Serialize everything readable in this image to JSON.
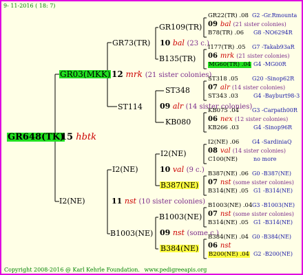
{
  "header": {
    "date": "9- 11-2016 ( 18: 7)"
  },
  "footer": {
    "copyright": "Copyright 2008-2016 @ Karl Kehrle Foundation.",
    "site": "www.pedigreeapis.org"
  },
  "root": {
    "label": "GR648(TK)",
    "num": "15",
    "code": "hbtk"
  },
  "g1": {
    "upper": {
      "label": "GR03(MKK)",
      "num": "12",
      "code": "mrk",
      "sisters": "(21 sister colonies)"
    },
    "lower": {
      "label": "I2(NE)"
    }
  },
  "g2": {
    "gr73": {
      "label": "GR73(TR)"
    },
    "st114": {
      "label": "ST114",
      "num": "09",
      "code": "alr",
      "sisters": "(14 sister colonies)"
    },
    "i2ne": {
      "label": "I2(NE)",
      "num": "11",
      "code": "nst",
      "sisters": "(10 sister colonies)"
    },
    "b1003": {
      "label": "B1003(NE)"
    }
  },
  "g3": {
    "gr109": {
      "label": "GR109(TR)",
      "num": "10",
      "code": "bal",
      "sisters": "(23 c.)"
    },
    "b135": {
      "label": "B135(TR)"
    },
    "st348": {
      "label": "ST348"
    },
    "kb080": {
      "label": "KB080"
    },
    "i2ne": {
      "label": "I2(NE)",
      "num": "10",
      "code": "val",
      "sisters": "(9 c.)"
    },
    "b387": {
      "label": "B387(NE)"
    },
    "b1003": {
      "label": "B1003(NE)",
      "num": "09",
      "code": "nst",
      "sisters": "(some c.)"
    },
    "b384": {
      "label": "B384(NE)"
    }
  },
  "g4": [
    {
      "top": "GR22(TR) .08",
      "topId": "G2 -Gr.Rmounta",
      "num": "09",
      "code": "bal",
      "sisters": "(21 sister colonies)",
      "bottom": "B78(TR) .06",
      "bottomId": "G8 -NO6294R"
    },
    {
      "top": "I177(TR) .05",
      "topId": "G7 -Takab93aR",
      "num": "06",
      "code": "mrk",
      "sisters": "(21 sister colonies)",
      "bottom": "MG60(TR) .04",
      "bottomId": "G4 -MG00R"
    },
    {
      "top": "ST318 .05",
      "topId": "G20 -Sinop62R",
      "num": "07",
      "code": "alr",
      "sisters": "(14 sister colonies)",
      "bottom": "ST343 .03",
      "bottomId": "G4 -Bayburt98-3"
    },
    {
      "top": "KB075 .04",
      "topId": "G3 -Carpath00R",
      "num": "06",
      "code": "nex",
      "sisters": "(12 sister colonies)",
      "bottom": "KB266 .03",
      "bottomId": "G4 -Sinop96R"
    },
    {
      "top": "I2(NE) .06",
      "topId": "G4 -SardiniaQ",
      "num": "08",
      "code": "val",
      "sisters": "(14 sister colonies)",
      "bottom": "C100(NE)",
      "bottomId": "no more"
    },
    {
      "top": "B387(NE) .06",
      "topId": "G0 -B387(NE)",
      "num": "07",
      "code": "nst",
      "sisters": "(some sister colonies)",
      "bottom": "B314(NE) .05",
      "bottomId": "G1 -B314(NE)"
    },
    {
      "top": "B1003(NE) .04",
      "topId": "G3 -B1003(NE)",
      "num": "07",
      "code": "nst",
      "sisters": "(some sister colonies)",
      "bottom": "B314(NE) .05",
      "bottomId": "G1 -B314(NE)"
    },
    {
      "top": "B384(NE) .04",
      "topId": "G0 -B384(NE)",
      "num": "06",
      "code": "nst",
      "sisters": "",
      "bottom": "B200(NE) .04",
      "bottomId": "G2 -B200(NE)"
    }
  ]
}
